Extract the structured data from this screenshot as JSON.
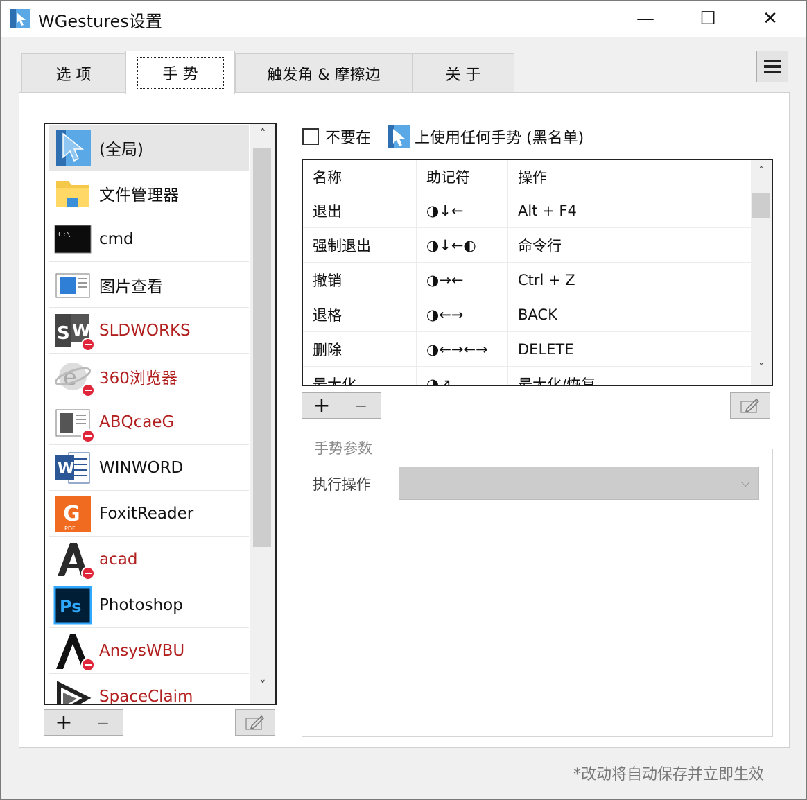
{
  "window": {
    "title": "WGestures设置",
    "min_glyph": "—",
    "max_glyph": "☐",
    "close_glyph": "✕"
  },
  "tabs": [
    {
      "label": "选 项"
    },
    {
      "label": "手 势"
    },
    {
      "label": "触发角 & 摩擦边"
    },
    {
      "label": "关 于"
    }
  ],
  "apps": {
    "items": [
      {
        "label": "(全局)",
        "icon": "cursor-icon",
        "blocked": false
      },
      {
        "label": "文件管理器",
        "icon": "folder-icon",
        "blocked": false
      },
      {
        "label": "cmd",
        "icon": "console-icon",
        "blocked": false
      },
      {
        "label": "图片查看",
        "icon": "image-viewer-icon",
        "blocked": false
      },
      {
        "label": "SLDWORKS",
        "icon": "solidworks-icon",
        "blocked": true
      },
      {
        "label": "360浏览器",
        "icon": "browser-icon",
        "blocked": true
      },
      {
        "label": "ABQcaeG",
        "icon": "abaqus-icon",
        "blocked": true
      },
      {
        "label": "WINWORD",
        "icon": "word-icon",
        "blocked": false
      },
      {
        "label": "FoxitReader",
        "icon": "foxit-icon",
        "blocked": false
      },
      {
        "label": "acad",
        "icon": "autocad-icon",
        "blocked": true
      },
      {
        "label": "Photoshop",
        "icon": "photoshop-icon",
        "blocked": false
      },
      {
        "label": "AnsysWBU",
        "icon": "ansys-icon",
        "blocked": true
      },
      {
        "label": "SpaceClaim",
        "icon": "spaceclaim-icon",
        "blocked": true
      }
    ],
    "icon_labels": {
      "cmd": "C:\\_",
      "word": "W",
      "ps": "Ps",
      "foxit": "G",
      "foxit_sub": "PDF"
    },
    "scroll_up": "˄",
    "scroll_down": "˅"
  },
  "list_buttons": {
    "add": "+",
    "remove": "—"
  },
  "blacklist": {
    "text_before": "不要在",
    "text_after": "上使用任何手势 (黑名单)",
    "checked": false
  },
  "gestures": {
    "headers": [
      "名称",
      "助记符",
      "操作"
    ],
    "rows": [
      {
        "name": "退出",
        "mnemonic": "◑↓←",
        "action": "Alt + F4"
      },
      {
        "name": "强制退出",
        "mnemonic": "◑↓←◐",
        "action": "命令行"
      },
      {
        "name": "撤销",
        "mnemonic": "◑→←",
        "action": "Ctrl + Z"
      },
      {
        "name": "退格",
        "mnemonic": "◑←→",
        "action": "BACK"
      },
      {
        "name": "删除",
        "mnemonic": "◑←→←→",
        "action": "DELETE"
      },
      {
        "name": "最大化",
        "mnemonic": "◑↗",
        "action": "最大化/恢复"
      }
    ],
    "scroll_up": "˄",
    "scroll_down": "˅"
  },
  "gesture_buttons": {
    "add": "+",
    "remove": "—"
  },
  "params": {
    "title": "手势参数",
    "exec_label": "执行操作",
    "exec_value": "",
    "chevron": "⌵"
  },
  "footer": "*改动将自动保存并立即生效",
  "colors": {
    "blocked_text": "#b21f1f",
    "accent_blue": "#3b8ed8",
    "block_badge": "#e0263a"
  }
}
